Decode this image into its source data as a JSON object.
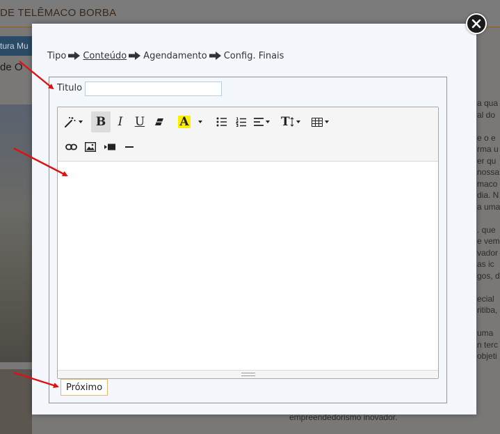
{
  "background": {
    "header_title": "DE TELÊMACO BORBA",
    "nav_item": "tura Mu",
    "subtitle": "de O",
    "side_text": [
      "a qua",
      "al do",
      "",
      "e o e",
      "rma u",
      "er qu",
      "nossa",
      "maco",
      "dia. N",
      "a uma",
      "",
      ". que",
      "e vem",
      "vador",
      "as ic",
      "gos, d",
      "",
      "ecial",
      "ritiba,",
      "",
      "uma",
      "n terc",
      "objeti"
    ],
    "bottom_text": "empreendedorismo inovador."
  },
  "modal": {
    "breadcrumb": [
      {
        "label": "Tipo",
        "active": false
      },
      {
        "label": "Conteúdo",
        "active": true
      },
      {
        "label": "Agendamento",
        "active": false
      },
      {
        "label": "Config. Finais",
        "active": false
      }
    ],
    "title_label": "Titulo",
    "title_value": "",
    "next_label": "Próximo"
  },
  "toolbar": {
    "bold": "B",
    "italic": "I",
    "underline": "U",
    "font_color": "A",
    "font_size": "T"
  },
  "colors": {
    "highlight": "#ffef00",
    "accent_border": "#e3b870",
    "annotation_arrow": "#e01010"
  },
  "icons": [
    "close-icon",
    "magic-wand-icon",
    "eraser-icon",
    "bullet-list-icon",
    "numbered-list-icon",
    "align-icon",
    "table-icon",
    "link-icon",
    "image-icon",
    "video-icon",
    "horizontal-rule-icon",
    "right-arrow-icon"
  ]
}
